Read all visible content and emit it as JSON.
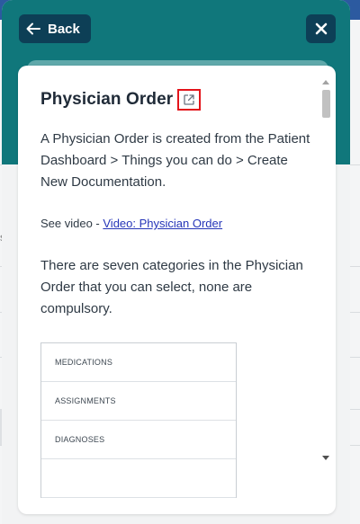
{
  "header": {
    "back_label": "Back",
    "close_icon": "close-icon",
    "back_icon": "arrow-left-icon"
  },
  "article": {
    "title": "Physician Order",
    "external_link_icon": "external-link-icon",
    "intro": "A Physician Order is created from the Patient Dashboard > Things you can do > Create New Documentation.",
    "video_prefix": "See video - ",
    "video_link": "Video: Physician Order",
    "categories_text": "There are seven categories in the Physician Order that you can select, none are compulsory.",
    "categories": [
      "MEDICATIONS",
      "ASSIGNMENTS",
      "DIAGNOSES",
      ""
    ]
  },
  "background": {
    "dash": "s"
  },
  "colors": {
    "header_teal": "#10777b",
    "button_navy": "#0d3f56",
    "highlight_red": "#e3141b",
    "link_blue": "#2535b8"
  }
}
